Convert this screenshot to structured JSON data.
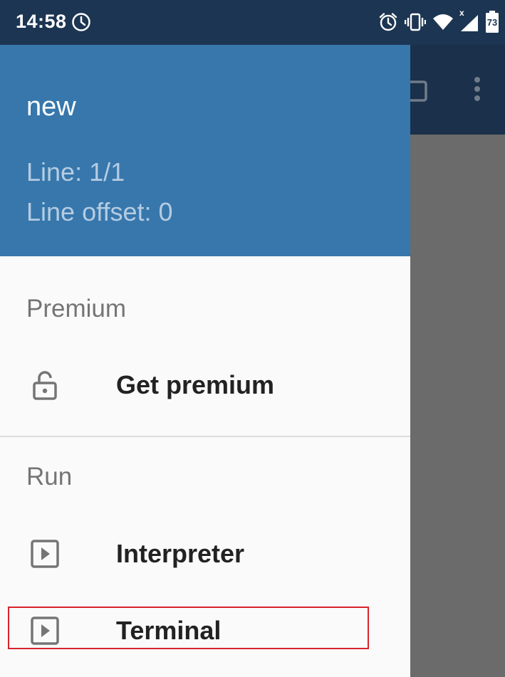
{
  "status_bar": {
    "time": "14:58",
    "battery_level": "73",
    "signal_marker": "x",
    "icons": [
      "clock-icon",
      "alarm-icon",
      "vibrate-icon",
      "wifi-icon",
      "signal-icon",
      "battery-icon"
    ]
  },
  "app": {
    "toolbar_icons": [
      "square-icon",
      "more-vert-icon"
    ]
  },
  "drawer": {
    "header": {
      "file_name": "new",
      "line": "Line: 1/1",
      "line_offset": "Line offset: 0"
    },
    "sections": [
      {
        "title": "Premium",
        "items": [
          {
            "label": "Get premium",
            "icon": "lock-icon"
          }
        ]
      },
      {
        "title": "Run",
        "items": [
          {
            "label": "Interpreter",
            "icon": "play-box-icon"
          },
          {
            "label": "Terminal",
            "icon": "play-box-icon"
          }
        ]
      }
    ]
  },
  "colors": {
    "status_bar_bg": "#1c3552",
    "drawer_header_bg": "#3777ac",
    "drawer_bg": "#fafafa",
    "highlight": "#d9232d"
  }
}
